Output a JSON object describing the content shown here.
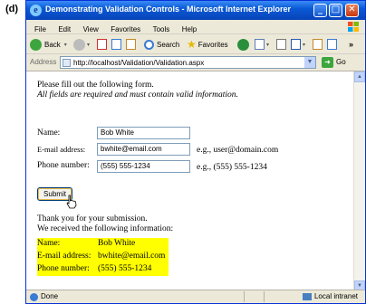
{
  "figure": {
    "label": "(d)"
  },
  "window": {
    "title": "Demonstrating Validation Controls - Microsoft Internet Explorer",
    "controls": {
      "minimize": "_",
      "maximize": "□",
      "close": "✕"
    }
  },
  "menu": {
    "items": [
      "File",
      "Edit",
      "View",
      "Favorites",
      "Tools",
      "Help"
    ]
  },
  "toolbar": {
    "back_label": "Back",
    "search_label": "Search",
    "favorites_label": "Favorites"
  },
  "address": {
    "label": "Address",
    "url": "http://localhost/Validation/Validation.aspx",
    "go_label": "Go"
  },
  "form": {
    "intro": "Please fill out the following form.",
    "note": "All fields are required and must contain valid information.",
    "fields": [
      {
        "label": "Name:",
        "value": "Bob White",
        "hint": ""
      },
      {
        "label": "E-mail address:",
        "value": "bwhite@email.com",
        "hint": "e.g., user@domain.com"
      },
      {
        "label": "Phone number:",
        "value": "(555) 555-1234",
        "hint": "e.g., (555) 555-1234"
      }
    ],
    "submit_label": "Submit"
  },
  "result": {
    "thanks": "Thank you for your submission.",
    "received": "We received the following information:",
    "rows": [
      {
        "label": "Name:",
        "value": "Bob White"
      },
      {
        "label": "E-mail address:",
        "value": "bwhite@email.com"
      },
      {
        "label": "Phone number:",
        "value": "(555) 555-1234"
      }
    ]
  },
  "status": {
    "text": "Done",
    "zone": "Local intranet"
  },
  "colors": {
    "highlight": "#ffff00",
    "titlebar": "#0a5ad6"
  }
}
